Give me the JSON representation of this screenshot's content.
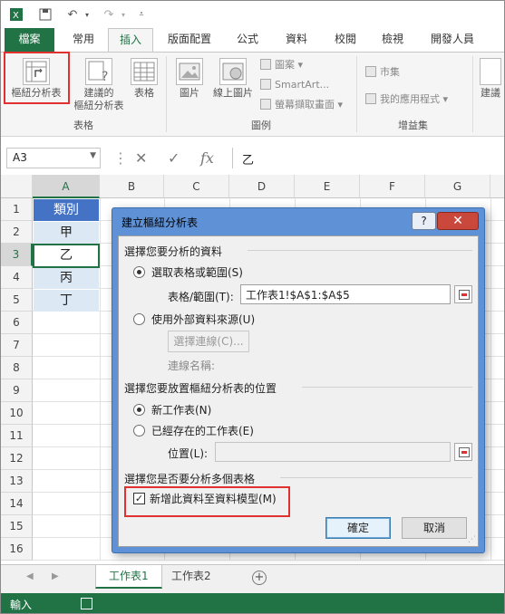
{
  "qat": {
    "save": "save-icon",
    "undo": "undo-icon",
    "redo": "redo-icon",
    "customize": "customize-icon"
  },
  "tabs": [
    "檔案",
    "常用",
    "插入",
    "版面配置",
    "公式",
    "資料",
    "校閱",
    "檢視",
    "開發人員"
  ],
  "active_tab": "插入",
  "ribbon": {
    "pivot": "樞紐分析表",
    "recommended_pivot_l1": "建議的",
    "recommended_pivot_l2": "樞紐分析表",
    "table": "表格",
    "group_tables": "表格",
    "picture": "圖片",
    "online_picture": "線上圖片",
    "shapes": "圖案",
    "smartart": "SmartArt...",
    "screenshot": "螢幕擷取畫面",
    "group_illustrations": "圖例",
    "store": "市集",
    "my_apps": "我的應用程式",
    "group_apps": "增益集",
    "recommended_chart": "建議"
  },
  "formula_bar": {
    "namebox": "A3",
    "value": "乙"
  },
  "columns": [
    "A",
    "B",
    "C",
    "D",
    "E",
    "F",
    "G"
  ],
  "rows": [
    "1",
    "2",
    "3",
    "4",
    "5",
    "6",
    "7",
    "8",
    "9",
    "10",
    "11",
    "12",
    "13",
    "14",
    "15",
    "16"
  ],
  "cells": {
    "A1": "類別",
    "A2": "甲",
    "A3": "乙",
    "A4": "丙",
    "A5": "丁"
  },
  "sheets": [
    "工作表1",
    "工作表2"
  ],
  "status": "輸入",
  "dialog": {
    "title": "建立樞紐分析表",
    "help": "?",
    "close": "✕",
    "sec1": "選擇您要分析的資料",
    "opt_range": "選取表格或範圍(S)",
    "range_label": "表格/範圍(T):",
    "range_value": "工作表1!$A$1:$A$5",
    "opt_external": "使用外部資料來源(U)",
    "choose_conn": "選擇連線(C)...",
    "conn_name": "連線名稱:",
    "sec2": "選擇您要放置樞紐分析表的位置",
    "opt_new": "新工作表(N)",
    "opt_existing": "已經存在的工作表(E)",
    "location_label": "位置(L):",
    "location_value": "",
    "sec3": "選擇您是否要分析多個表格",
    "checkbox_label": "新增此資料至資料模型(M)",
    "ok": "確定",
    "cancel": "取消"
  },
  "colors": {
    "excel_green": "#217346",
    "header_blue": "#4472c4",
    "band_blue": "#dde8f5",
    "dialog_blue": "#5e91d6",
    "highlight_red": "#e03030"
  }
}
